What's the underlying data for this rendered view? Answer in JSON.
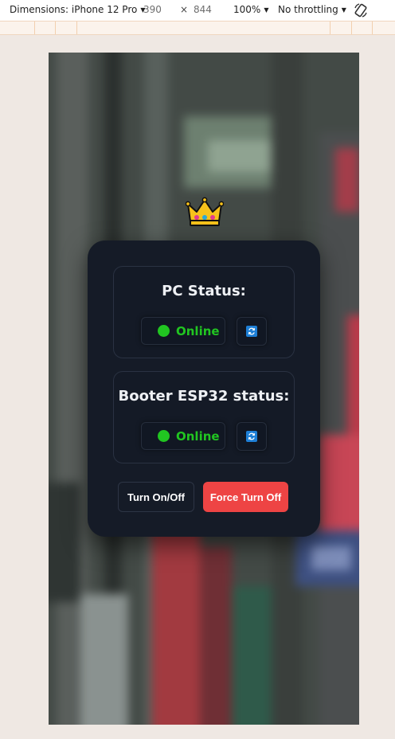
{
  "devtools": {
    "device_label": "Dimensions: iPhone 12 Pro",
    "width_value": "390",
    "times_sign": "×",
    "height_value": "844",
    "zoom": "100%",
    "throttling": "No throttling"
  },
  "app": {
    "crown_emoji": "👑",
    "pc_status": {
      "title": "PC Status:",
      "state": "Online",
      "refresh_icon": "refresh-icon"
    },
    "booter_status": {
      "title": "Booter ESP32 status:",
      "state": "Online",
      "refresh_icon": "refresh-icon"
    },
    "buttons": {
      "toggle_label": "Turn On/Off",
      "force_label": "Force Turn Off"
    },
    "colors": {
      "online": "#21c521",
      "danger": "#ee4444",
      "card": "#151b27"
    }
  }
}
